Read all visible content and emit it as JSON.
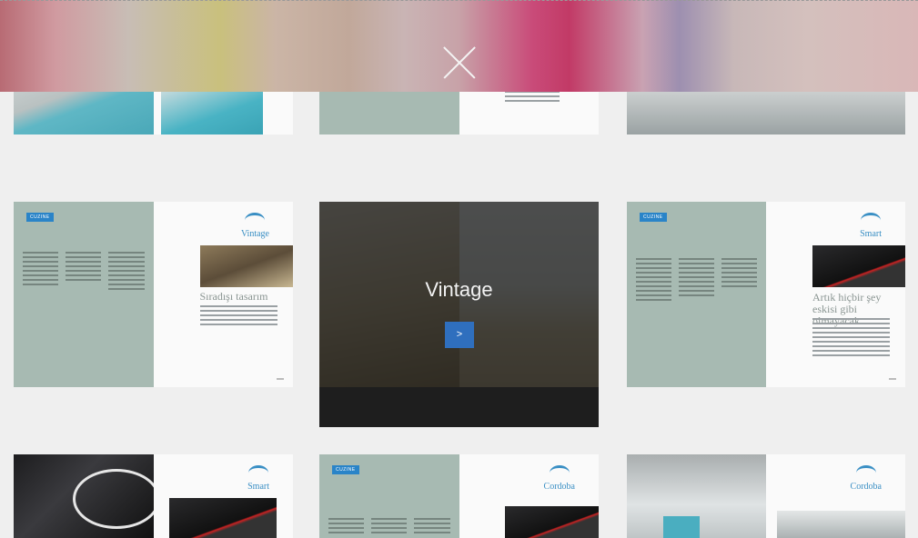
{
  "header": {
    "close_label": ""
  },
  "catalogs": [
    {
      "id": "top-left"
    },
    {
      "id": "top-middle"
    },
    {
      "id": "top-right"
    },
    {
      "badge": "CUZINE",
      "logo": "Vintage",
      "heading": "Sıradışı tasarım"
    },
    {
      "badge": "",
      "logo": "Vintage",
      "overlay_title": "Vintage",
      "button_label": ">"
    },
    {
      "badge": "CUZINE",
      "logo": "Smart",
      "heading": "Artık hiçbir şey eskisi gibi olmayacak"
    },
    {
      "logo": "Smart"
    },
    {
      "badge": "CUZINE",
      "logo": "Cordoba"
    },
    {
      "logo": "Cordoba"
    }
  ]
}
